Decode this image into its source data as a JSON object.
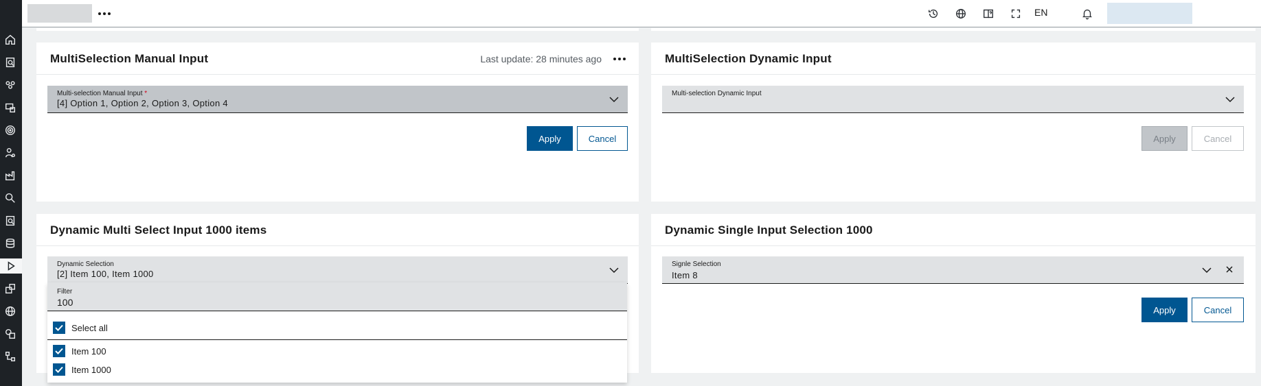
{
  "header": {
    "lang": "EN",
    "icons": [
      "history-icon",
      "globe-icon",
      "help-book-icon",
      "fullscreen-icon",
      "bell-icon",
      "user-icon"
    ]
  },
  "sidebar": {
    "icons": [
      "home-icon",
      "report-search-icon",
      "groups-icon",
      "devices-icon",
      "target-icon",
      "user-settings-icon",
      "factory-icon",
      "search-icon",
      "document-search-icon",
      "database-icon",
      "play-icon",
      "widgets-icon",
      "world-icon",
      "shapes-icon",
      "network-icon"
    ],
    "active": "play-icon"
  },
  "cards": {
    "manual": {
      "title": "MultiSelection Manual Input",
      "last_update": "Last update: 28 minutes ago",
      "field_label": "Multi-selection Manual Input",
      "required_mark": "*",
      "field_value": "[4]  Option 1, Option 2, Option 3, Option 4",
      "apply": "Apply",
      "cancel": "Cancel"
    },
    "dynamic": {
      "title": "MultiSelection Dynamic Input",
      "field_label": "Multi-selection Dynamic Input",
      "field_value": "",
      "apply": "Apply",
      "cancel": "Cancel"
    },
    "multi1000": {
      "title": "Dynamic Multi Select Input 1000 items",
      "field_label": "Dynamic Selection",
      "field_value": "[2]  Item 100, Item 1000",
      "dropdown": {
        "filter_label": "Filter",
        "filter_value": "100",
        "select_all": "Select all",
        "options": [
          "Item 100",
          "Item 1000"
        ]
      }
    },
    "single1000": {
      "title": "Dynamic Single Input Selection 1000",
      "field_label": "Signle Selection",
      "field_value": "Item 8",
      "apply": "Apply",
      "cancel": "Cancel"
    }
  },
  "colors": {
    "primary": "#005691",
    "sidebar_bg": "#1e2226",
    "required": "#d0021b"
  }
}
